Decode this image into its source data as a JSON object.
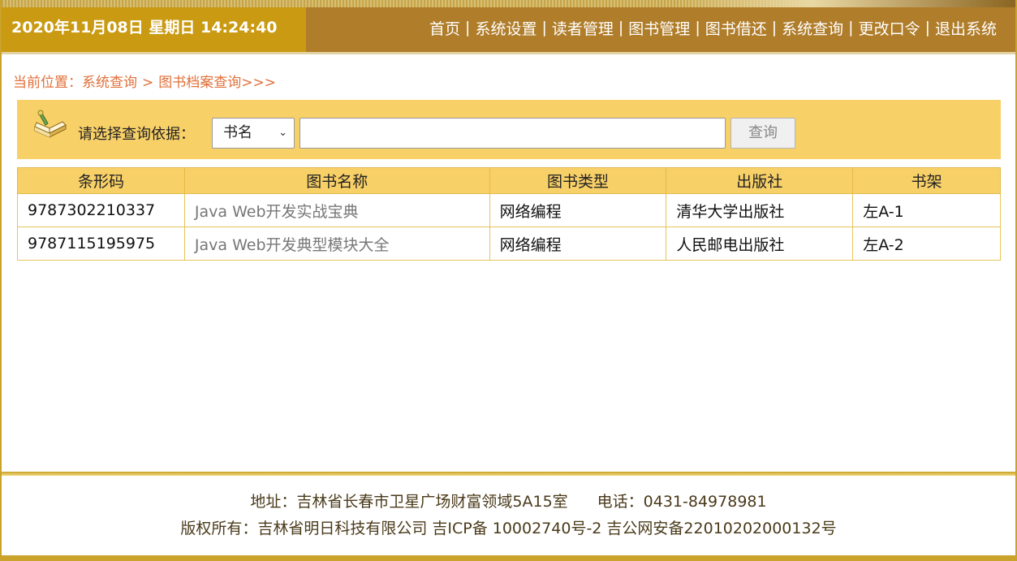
{
  "header": {
    "datetime": "2020年11月08日 星期日 14:24:40",
    "nav": [
      {
        "label": "首页",
        "name": "nav-home"
      },
      {
        "label": "系统设置",
        "name": "nav-system-settings"
      },
      {
        "label": "读者管理",
        "name": "nav-reader-management"
      },
      {
        "label": "图书管理",
        "name": "nav-book-management"
      },
      {
        "label": "图书借还",
        "name": "nav-book-borrow-return"
      },
      {
        "label": "系统查询",
        "name": "nav-system-query"
      },
      {
        "label": "更改口令",
        "name": "nav-change-password"
      },
      {
        "label": "退出系统",
        "name": "nav-logout"
      }
    ],
    "separator": "|"
  },
  "breadcrumb": {
    "prefix": "当前位置：",
    "level1": "系统查询",
    "arrow": ">",
    "level2": "图书档案查询>>>"
  },
  "search": {
    "label": "请选择查询依据：",
    "selected_option": "书名",
    "input_value": "",
    "button_label": "查询",
    "icon": "book-icon"
  },
  "table": {
    "headers": [
      "条形码",
      "图书名称",
      "图书类型",
      "出版社",
      "书架"
    ],
    "rows": [
      [
        "9787302210337",
        "Java Web开发实战宝典",
        "网络编程",
        "清华大学出版社",
        "左A-1"
      ],
      [
        "9787115195975",
        "Java Web开发典型模块大全",
        "网络编程",
        "人民邮电出版社",
        "左A-2"
      ]
    ]
  },
  "footer": {
    "address": "地址：吉林省长春市卫星广场财富领域5A15室",
    "phone": "电话：0431-84978981",
    "copyright": "版权所有：吉林省明日科技有限公司 吉ICP备 10002740号-2 吉公网安备22010202000132号"
  },
  "colors": {
    "header_bg": "#b07d2a",
    "date_bg": "#c99a12",
    "search_bg": "#f8d068",
    "breadcrumb": "#e0703a",
    "border_gold": "#c9a32c"
  }
}
